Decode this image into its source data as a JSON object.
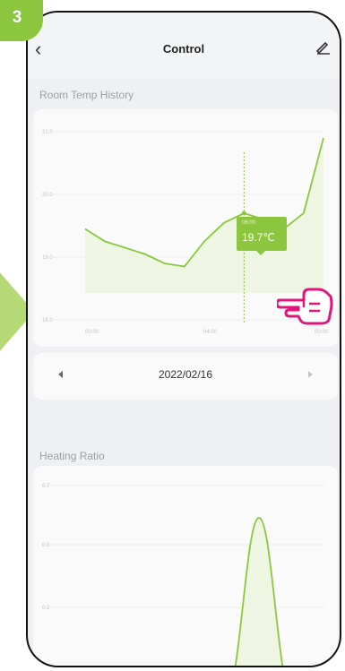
{
  "step_badge": "3",
  "header": {
    "title": "Control"
  },
  "room_temp": {
    "label": "Room Temp History",
    "tooltip_time": "06:00",
    "tooltip_value": "19.7℃"
  },
  "date_nav": {
    "date": "2022/02/16"
  },
  "heating": {
    "label": "Heating Ratio"
  },
  "colors": {
    "accent": "#8cc63f",
    "hand": "#e0157b",
    "line": "#8cc63f"
  },
  "chart_data": [
    {
      "type": "area",
      "title": "Room Temp History",
      "y_ticks": [
        "21.0",
        "20.0",
        "19.0",
        "18.0"
      ],
      "x_ticks": [
        "00:00",
        "04:00",
        "00:00"
      ],
      "ylim": [
        18.0,
        21.0
      ],
      "x": [
        0,
        1,
        2,
        3,
        4,
        5,
        6,
        7,
        8,
        9,
        10,
        11,
        12,
        13,
        14,
        15,
        16,
        17
      ],
      "values": [
        19.45,
        19.25,
        19.15,
        19.05,
        18.9,
        18.85,
        19.25,
        19.55,
        19.7,
        19.6,
        19.45,
        19.7,
        20.9
      ],
      "highlight": {
        "time": "06:00",
        "value": 19.7
      }
    },
    {
      "type": "area",
      "title": "Heating Ratio",
      "y_ticks": [
        "0.7",
        "0.5",
        "0.2"
      ],
      "values": [
        0,
        0,
        0,
        0,
        0,
        0,
        0,
        0.12,
        0.6,
        0.12,
        0,
        0
      ]
    }
  ]
}
